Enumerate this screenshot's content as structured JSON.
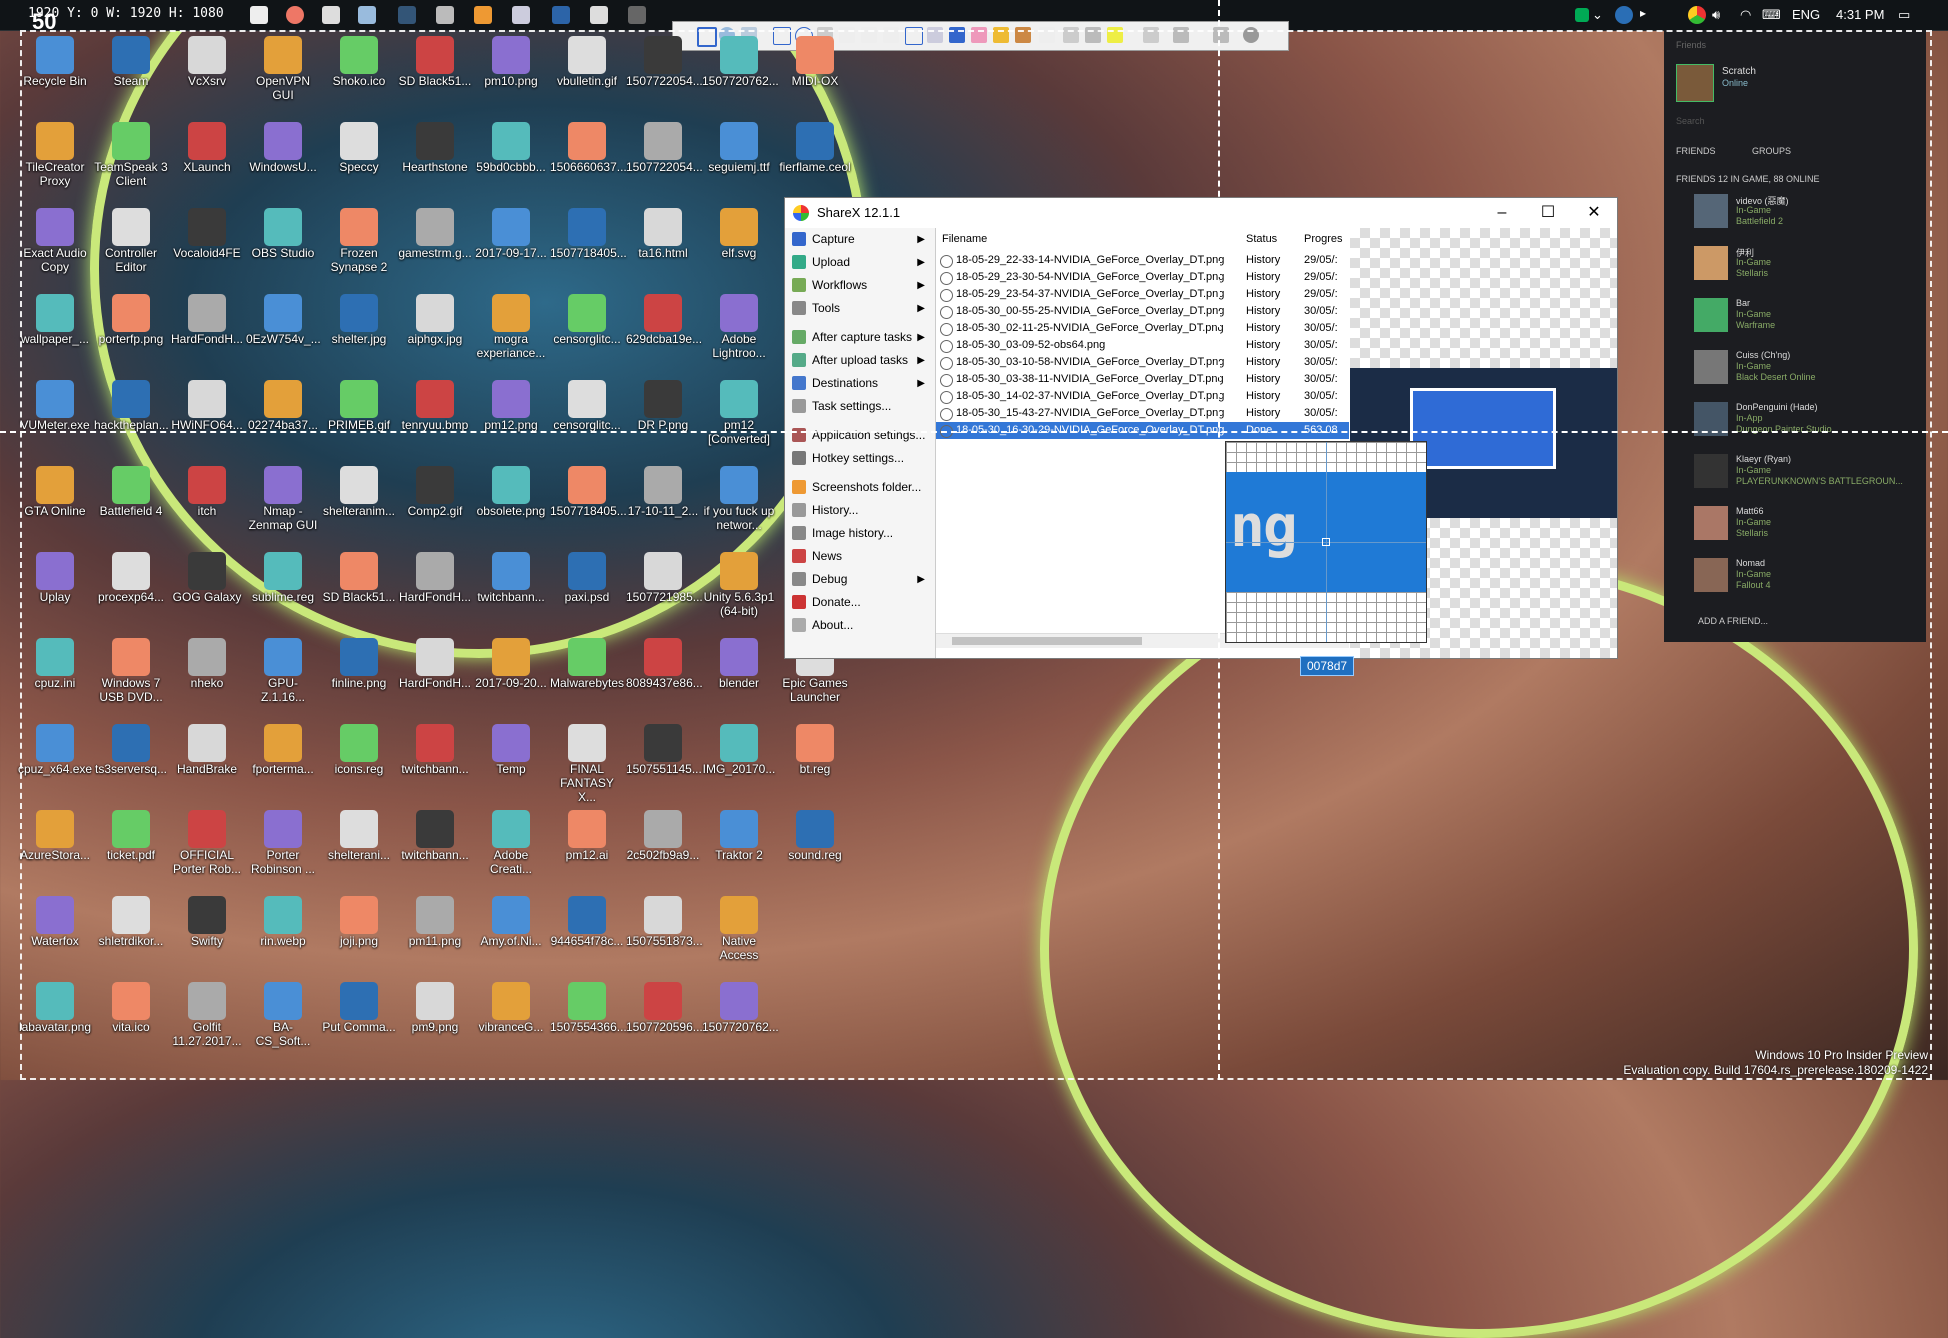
{
  "taskbar": {
    "coords": "1920 Y: 0 W: 1920 H: 1080",
    "counter": "50",
    "lang": "ENG",
    "time": "4:31 PM"
  },
  "desktop": {
    "icons": [
      "Recycle Bin",
      "Steam",
      "VcXsrv",
      "OpenVPN GUI",
      "Shoko.ico",
      "SD Black51...",
      "pm10.png",
      "vbulletin.gif",
      "1507722054...",
      "1507720762...",
      "MIDI-OX",
      "TileCreator Proxy",
      "TeamSpeak 3 Client",
      "XLaunch",
      "WindowsU...",
      "Speccy",
      "Hearthstone",
      "59bd0cbbb...",
      "1506660637...",
      "1507722054...",
      "seguiemj.ttf",
      "fierflame.ceol",
      "Exact Audio Copy",
      "Controller Editor",
      "Vocaloid4FE",
      "OBS Studio",
      "Frozen Synapse 2",
      "gamestrm.g...",
      "2017-09-17...",
      "1507718405...",
      "ta16.html",
      "elf.svg",
      "wallpaper_...",
      "porterfp.png",
      "HardFondH...",
      "0EzW754v_...",
      "shelter.jpg",
      "aiphgx.jpg",
      "mogra experiance...",
      "censorglitc...",
      "629dcba19e...",
      "Adobe Lightroo...",
      "VUMeter.exe",
      "hacktheplan...",
      "HWiNFO64...",
      "02274ba37...",
      "PRIMEB.gif",
      "tenryuu.bmp",
      "pm12.png",
      "censorglitc...",
      "DR P.png",
      "pm12 [Converted]",
      "GTA Online",
      "Battlefield 4",
      "itch",
      "Nmap - Zenmap GUI",
      "shelteranim...",
      "Comp2.gif",
      "obsolete.png",
      "1507718405...",
      "17-10-11_2...",
      "if you fuck up networ...",
      "Uplay",
      "procexp64...",
      "GOG Galaxy",
      "sublime.reg",
      "SD Black51...",
      "HardFondH...",
      "twitchbann...",
      "paxi.psd",
      "1507721985...",
      "Unity 5.6.3p1 (64-bit)",
      "cpuz.ini",
      "Windows 7 USB DVD...",
      "nheko",
      "GPU-Z.1.16...",
      "finline.png",
      "HardFondH...",
      "2017-09-20...",
      "Malwarebytes",
      "8089437e86...",
      "blender",
      "Epic Games Launcher",
      "cpuz_x64.exe",
      "ts3serversq...",
      "HandBrake",
      "fporterma...",
      "icons.reg",
      "twitchbann...",
      "Temp",
      "FINAL FANTASY X...",
      "1507551145...",
      "IMG_20170...",
      "bt.reg",
      "AzureStora...",
      "ticket.pdf",
      "OFFICIAL Porter Rob...",
      "Porter Robinson ...",
      "shelterani...",
      "twitchbann...",
      "Adobe Creati...",
      "pm12.ai",
      "2c502fb9a9...",
      "Traktor 2",
      "sound.reg",
      "Waterfox",
      "shletrdikor...",
      "Swifty",
      "rin.webp",
      "joji.png",
      "pm11.png",
      "Amy.of.Ni...",
      "944654f78c...",
      "1507551873...",
      "Native Access",
      "labavatar.png",
      "vita.ico",
      "Golfit 11.27.2017...",
      "BA-CS_Soft...",
      "Put Comma...",
      "pm9.png",
      "vibranceG...",
      "1507554366...",
      "1507720596...",
      "1507720762..."
    ]
  },
  "sharex": {
    "title": "ShareX 12.1.1",
    "menu": [
      {
        "label": "Capture",
        "sub": true
      },
      {
        "label": "Upload",
        "sub": true
      },
      {
        "label": "Workflows",
        "sub": true
      },
      {
        "label": "Tools",
        "sub": true
      },
      {
        "label": "After capture tasks",
        "sub": true
      },
      {
        "label": "After upload tasks",
        "sub": true
      },
      {
        "label": "Destinations",
        "sub": true
      },
      {
        "label": "Task settings...",
        "sub": false
      },
      {
        "label": "Application settings...",
        "sub": false
      },
      {
        "label": "Hotkey settings...",
        "sub": false
      },
      {
        "label": "Screenshots folder...",
        "sub": false
      },
      {
        "label": "History...",
        "sub": false
      },
      {
        "label": "Image history...",
        "sub": false
      },
      {
        "label": "News",
        "sub": false
      },
      {
        "label": "Debug",
        "sub": true
      },
      {
        "label": "Donate...",
        "sub": false
      },
      {
        "label": "About...",
        "sub": false
      }
    ],
    "columns": {
      "filename": "Filename",
      "status": "Status",
      "progress": "Progres"
    },
    "rows": [
      {
        "file": "18-05-29_22-33-14-NVIDIA_GeForce_Overlay_DT.png",
        "status": "History",
        "progress": "29/05/:"
      },
      {
        "file": "18-05-29_23-30-54-NVIDIA_GeForce_Overlay_DT.png",
        "status": "History",
        "progress": "29/05/:"
      },
      {
        "file": "18-05-29_23-54-37-NVIDIA_GeForce_Overlay_DT.png",
        "status": "History",
        "progress": "29/05/:"
      },
      {
        "file": "18-05-30_00-55-25-NVIDIA_GeForce_Overlay_DT.png",
        "status": "History",
        "progress": "30/05/:"
      },
      {
        "file": "18-05-30_02-11-25-NVIDIA_GeForce_Overlay_DT.png",
        "status": "History",
        "progress": "30/05/:"
      },
      {
        "file": "18-05-30_03-09-52-obs64.png",
        "status": "History",
        "progress": "30/05/:"
      },
      {
        "file": "18-05-30_03-10-58-NVIDIA_GeForce_Overlay_DT.png",
        "status": "History",
        "progress": "30/05/:"
      },
      {
        "file": "18-05-30_03-38-11-NVIDIA_GeForce_Overlay_DT.png",
        "status": "History",
        "progress": "30/05/:"
      },
      {
        "file": "18-05-30_14-02-37-NVIDIA_GeForce_Overlay_DT.png",
        "status": "History",
        "progress": "30/05/:"
      },
      {
        "file": "18-05-30_15-43-27-NVIDIA_GeForce_Overlay_DT.png",
        "status": "History",
        "progress": "30/05/:"
      },
      {
        "file": "18-05-30_16-30-29-NVIDIA_GeForce_Overlay_DT.png",
        "status": "Done",
        "progress": "563.08"
      }
    ],
    "magnifier_text": "ng",
    "color_hex": "0078d7"
  },
  "steam": {
    "header": "Friends",
    "user_name": "Scratch",
    "user_status": "Online",
    "search_placeholder": "Search",
    "tabs": [
      "FRIENDS",
      "GROUPS"
    ],
    "section": "FRIENDS  12 IN GAME, 88 ONLINE",
    "friends": [
      {
        "name": "videvo (惡魔)",
        "state": "In-Game",
        "game": "Battlefield 2"
      },
      {
        "name": "伊利",
        "state": "In-Game",
        "game": "Stellaris"
      },
      {
        "name": "Bar",
        "state": "In-Game",
        "game": "Warframe"
      },
      {
        "name": "Cuiss (Ch'ng)",
        "state": "In-Game",
        "game": "Black Desert Online"
      },
      {
        "name": "DonPenguini (Hade)",
        "state": "In-App",
        "game": "Dungeon Painter Studio"
      },
      {
        "name": "Klaeyr (Ryan)",
        "state": "In-Game",
        "game": "PLAYERUNKNOWN'S BATTLEGROUN..."
      },
      {
        "name": "Matt66",
        "state": "In-Game",
        "game": "Stellaris"
      },
      {
        "name": "Nomad",
        "state": "In-Game",
        "game": "Fallout 4"
      }
    ],
    "add_friend": "ADD A FRIEND..."
  },
  "watermark": {
    "line1": "Windows 10 Pro Insider Preview",
    "line2": "Evaluation copy. Build 17604.rs_prerelease.180209-1422"
  }
}
